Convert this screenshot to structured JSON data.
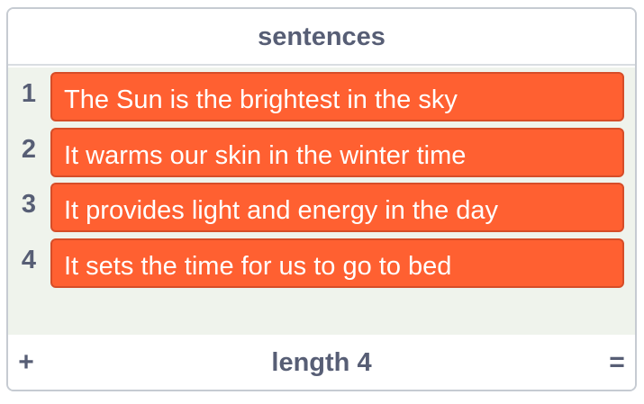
{
  "list": {
    "title": "sentences",
    "items": [
      {
        "index": "1",
        "text": "The Sun is the brightest in the sky"
      },
      {
        "index": "2",
        "text": "It warms our skin in the winter time"
      },
      {
        "index": "3",
        "text": "It provides light and energy in the day"
      },
      {
        "index": "4",
        "text": "It sets the time for us to go to bed"
      }
    ],
    "footer": {
      "add_label": "+",
      "length_label": "length 4",
      "resize_label": "="
    }
  },
  "colors": {
    "item_background": "#ff6031",
    "body_background": "#eff3ec",
    "text": "#575e75"
  }
}
